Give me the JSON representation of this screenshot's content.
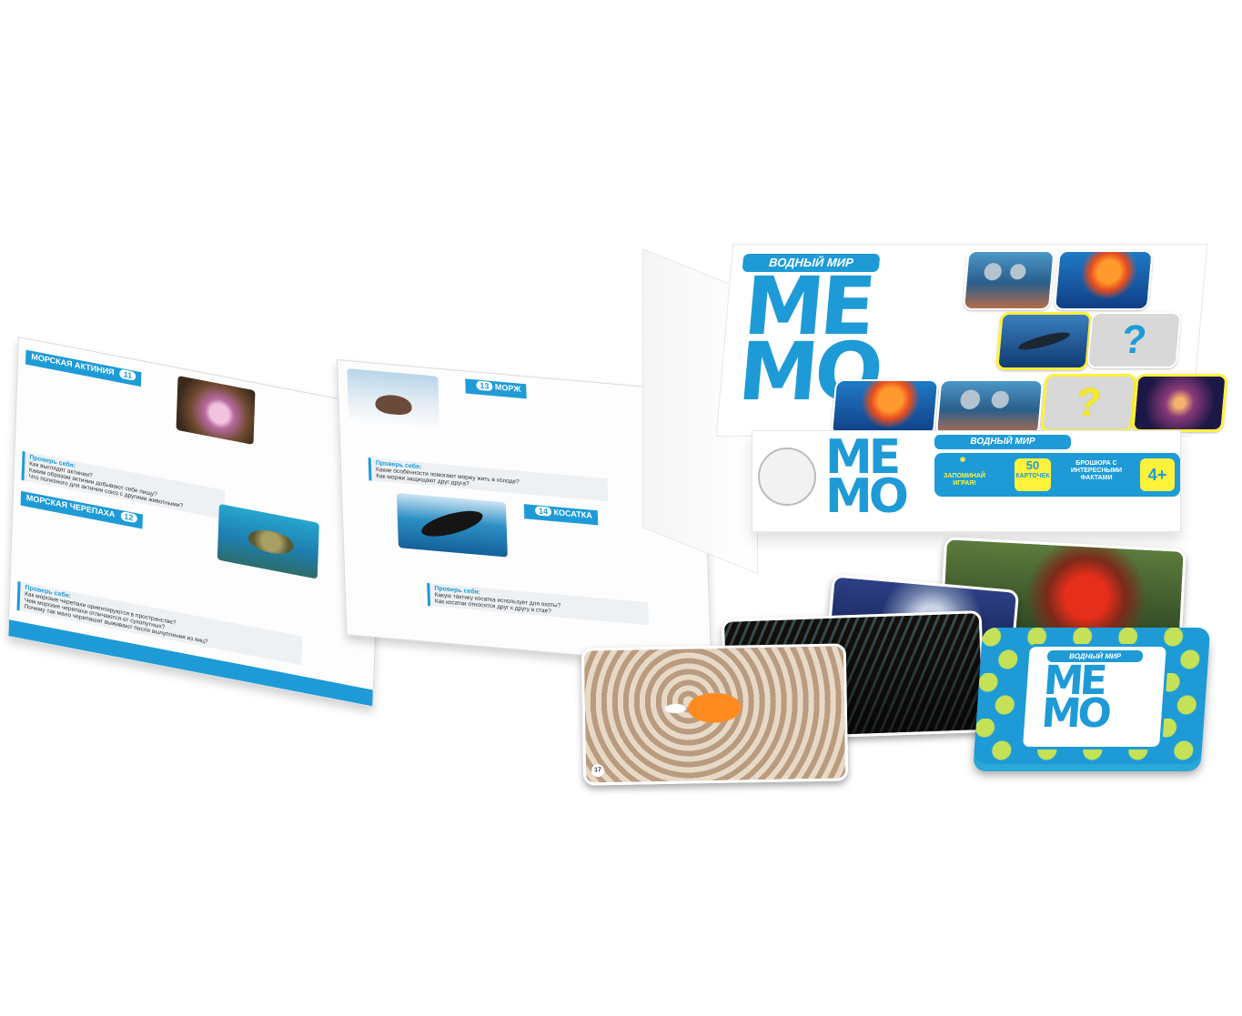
{
  "box": {
    "title": "ВОДНЫЙ МИР",
    "memo_line1": "МЕ",
    "memo_line2": "МО",
    "front_title": "ВОДНЫЙ МИР",
    "front_memo1": "МЕ",
    "front_memo2": "МО",
    "badge_play": "ЗАПОМИНАЙ ИГРАЯ!",
    "badge_count": "50",
    "badge_count_label": "КАРТОЧЕК",
    "badge_brochure": "БРОШЮРА С ИНТЕРЕСНЫМИ ФАКТАМИ",
    "badge_age": "4+",
    "tile_q": "?"
  },
  "booklet": {
    "left": {
      "section1_title": "МОРСКАЯ АКТИНИЯ",
      "section1_num": "11",
      "quiz1_title": "Проверь себя:",
      "quiz1_q1": "Как выглядят актинии?",
      "quiz1_q2": "Каким образом актинии добывают себе пищу?",
      "quiz1_q3": "Что полезного для актинии союз с другими животными?",
      "section2_title": "МОРСКАЯ ЧЕРЕПАХА",
      "section2_num": "12",
      "quiz2_title": "Проверь себя:",
      "quiz2_q1": "Как морские черепахи ориентируются в пространстве?",
      "quiz2_q2": "Чем морские черепахи отличаются от сухопутных?",
      "quiz2_q3": "Почему так мало черепашат выживают после вылупления из яиц?"
    },
    "right": {
      "section1_title": "МОРЖ",
      "section1_num": "13",
      "quiz1_title": "Проверь себя:",
      "quiz1_q1": "Какие особенности помогают моржу жить в холоде?",
      "quiz1_q2": "Как моржи защищают друг друга?",
      "section2_title": "КОСАТКА",
      "section2_num": "14",
      "quiz2_title": "Проверь себя:",
      "quiz2_q1": "Какую тактику косатка использует для охоты?",
      "quiz2_q2": "Как косатки относятся друг к другу в стае?"
    }
  },
  "deck": {
    "title": "ВОДНЫЙ МИР",
    "memo1": "МЕ",
    "memo2": "МО"
  },
  "cards": {
    "clown_num": "17"
  },
  "colors": {
    "brand_blue": "#1e9bd7",
    "highlight_yellow": "#fff23a"
  }
}
